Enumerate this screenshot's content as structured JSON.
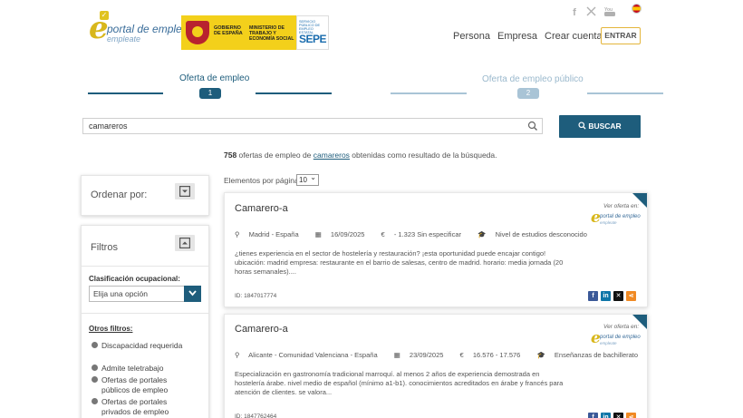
{
  "header": {
    "logo_title": "portal de empleo",
    "logo_subtitle": "empleate",
    "gov_text": "GOBIERNO DE ESPAÑA",
    "ministry_text": "MINISTERIO DE TRABAJO Y ECONOMÍA SOCIAL",
    "sepe_small": "SERVICIO PÚBLICO DE EMPLEO ESTATAL",
    "sepe_big": "SEPE",
    "nav": [
      "Persona",
      "Empresa",
      "Crear cuenta"
    ],
    "enter_label": "ENTRAR",
    "socials": [
      "facebook-icon",
      "x-icon",
      "youtube-icon"
    ],
    "language_flag": "spain-flag-icon"
  },
  "steps": [
    {
      "label": "Oferta de empleo",
      "number": "1",
      "active": true
    },
    {
      "label": "Oferta de empleo público",
      "number": "2",
      "active": false
    }
  ],
  "search": {
    "value": "camareros",
    "button_label": "BUSCAR"
  },
  "results": {
    "count": "758",
    "text_before": " ofertas de empleo de ",
    "keyword": "camareros",
    "text_after": " obtenidas como resultado de la búsqueda."
  },
  "pagination": {
    "label": "Elementos por página",
    "selected": "10"
  },
  "sidebar": {
    "sort_label": "Ordenar por:",
    "filters_label": "Filtros",
    "classification_label": "Clasificación ocupacional:",
    "classification_placeholder": "Elija una opción",
    "other_filters_label": "Otros filtros:",
    "options": [
      "Discapacidad requerida",
      "Admite teletrabajo",
      "Ofertas de portales públicos de empleo",
      "Ofertas de portales privados de empleo"
    ]
  },
  "jobs": [
    {
      "title": "Camarero-a",
      "location": "Madrid - España",
      "date": "16/09/2025",
      "salary": "- 1.323 Sin especificar",
      "education": "Nivel de estudios desconocido",
      "description": "¿tienes experiencia en el sector de hostelería y restauración? ¡esta oportunidad puede encajar contigo! ubicación: madrid empresa: restaurante en el barrio de salesas, centro de madrid. horario: media jornada (20 horas semanales)....",
      "id": "ID: 1847017774",
      "ver_oferta": "Ver oferta en:",
      "source_title": "portal de empleo",
      "source_subtitle": "empleate"
    },
    {
      "title": "Camarero-a",
      "location": "Alicante - Comunidad Valenciana - España",
      "date": "23/09/2025",
      "salary": "16.576 - 17.576",
      "education": "Enseñanzas de bachillerato",
      "description": "Especialización en gastronomía tradicional marroquí. al menos 2 años de experiencia demostrada en hostelería árabe. nivel medio de español (mínimo a1-b1). conocimientos acreditados en árabe y francés para atención de clientes. se valora...",
      "id": "ID: 1847762464",
      "ver_oferta": "Ver oferta en:",
      "source_title": "portal de empleo",
      "source_subtitle": "empleate"
    }
  ],
  "share_icons": [
    "facebook-share-icon",
    "linkedin-share-icon",
    "x-share-icon",
    "share-icon"
  ],
  "colors": {
    "primary": "#1e5d7c",
    "accent_yellow": "#d8b71c",
    "step_inactive": "#a9c4d6"
  }
}
